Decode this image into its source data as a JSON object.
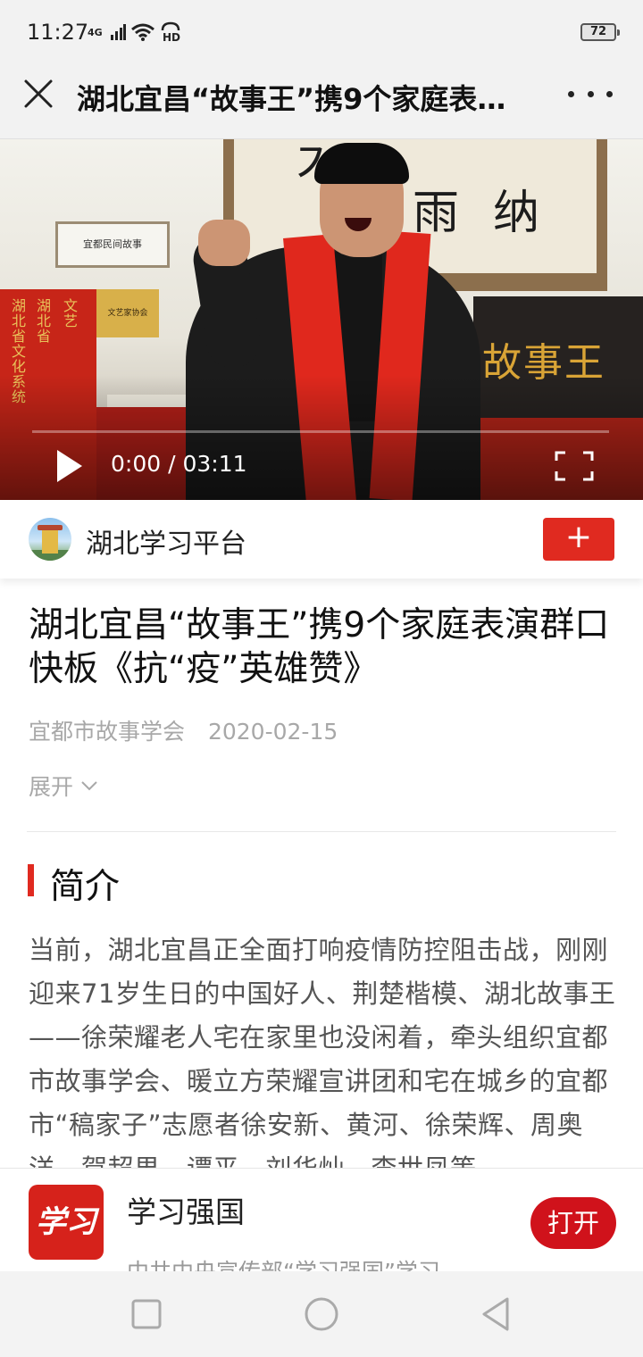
{
  "status_bar": {
    "time": "11:27",
    "network": "4G",
    "hd": "HD",
    "battery": "72"
  },
  "title_bar": {
    "title": "湖北宜昌“故事王”携9个家庭表演群口快板《抗“疫”英雄赞》"
  },
  "video": {
    "current_time": "0:00",
    "duration": "03:11",
    "time_display": "0:00 / 03:11",
    "progress": 0
  },
  "channel": {
    "name": "湖北学习平台",
    "follow_label": "+"
  },
  "article": {
    "title": "湖北宜昌“故事王”携9个家庭表演群口快板《抗“疫”英雄赞》",
    "author": "宜都市故事学会",
    "date": "2020-02-15",
    "expand_label": "展开"
  },
  "intro": {
    "heading": "简介",
    "text": "当前，湖北宜昌正全面打响疫情防控阻击战，刚刚迎来71岁生日的中国好人、荆楚楷模、湖北故事王——徐荣耀老人宅在家里也没闲着，牵头组织宜都市故事学会、暖立方荣耀宣讲团和宅在城乡的宜都市“稿家子”志愿者徐安新、黄河、徐荣辉、周奥洋、賀超男、谭平、刘华灿、李世凤等"
  },
  "app_banner": {
    "icon_text": "学习",
    "name": "学习强国",
    "subtitle": "中共中央宣传部“学习强国”学习",
    "open_label": "打开"
  },
  "colors": {
    "accent_red": "#e02a20",
    "open_red": "#d0121b",
    "text_gray": "#a8a8a8"
  }
}
